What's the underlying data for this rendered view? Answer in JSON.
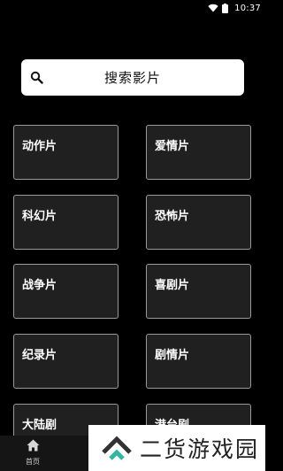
{
  "status_bar": {
    "time": "10:37",
    "icons": [
      "wifi-icon",
      "battery-icon"
    ]
  },
  "search": {
    "label": "搜索影片",
    "icon": "search-icon"
  },
  "categories": [
    {
      "label": "动作片"
    },
    {
      "label": "爱情片"
    },
    {
      "label": "科幻片"
    },
    {
      "label": "恐怖片"
    },
    {
      "label": "战争片"
    },
    {
      "label": "喜剧片"
    },
    {
      "label": "纪录片"
    },
    {
      "label": "剧情片"
    },
    {
      "label": "大陆剧"
    },
    {
      "label": "港台剧"
    }
  ],
  "bottom_nav": {
    "items": [
      {
        "label": "首页",
        "icon": "home-icon"
      }
    ]
  },
  "watermark": {
    "text": "二货游戏园"
  },
  "colors": {
    "background": "#000000",
    "card_background": "#202020",
    "card_border": "#9a9a9a",
    "search_background": "#ffffff",
    "text_primary": "#ffffff"
  }
}
